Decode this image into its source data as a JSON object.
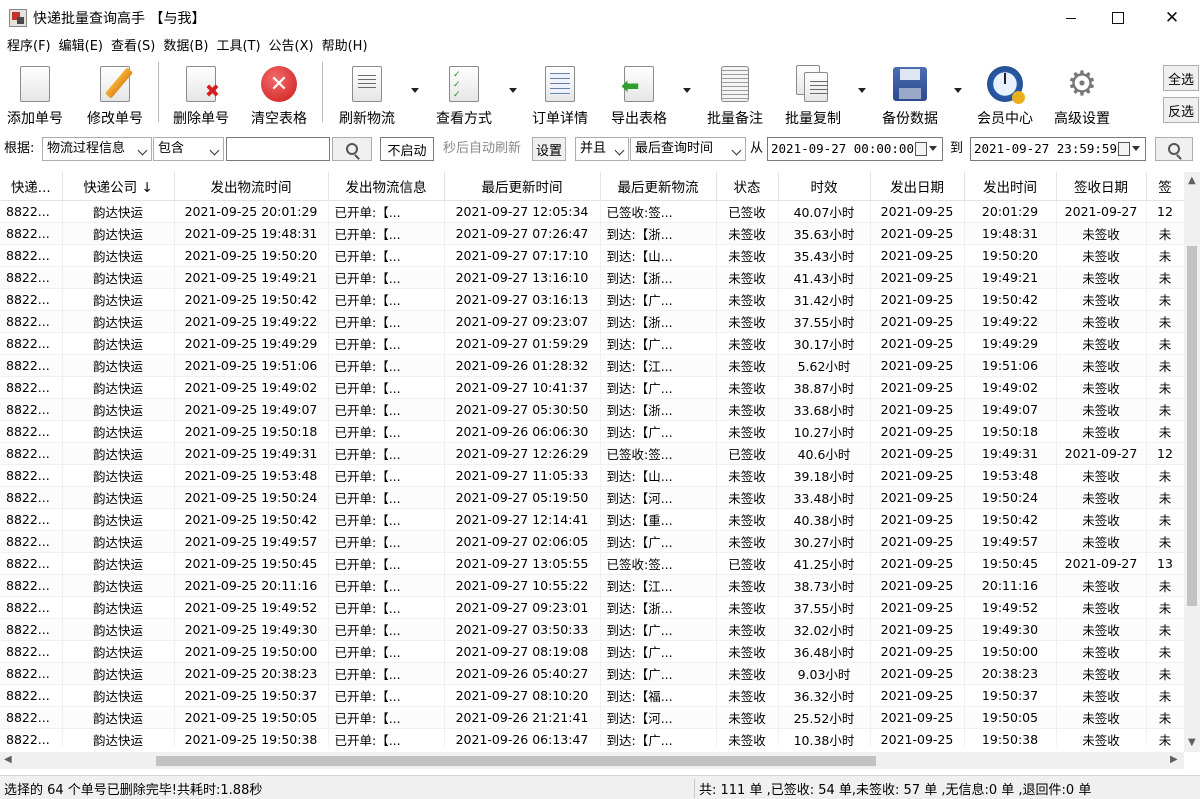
{
  "window": {
    "title": "快递批量查询高手 【与我】"
  },
  "menu": [
    "程序(F)",
    "编辑(E)",
    "查看(S)",
    "数据(B)",
    "工具(T)",
    "公告(X)",
    "帮助(H)"
  ],
  "toolbar": {
    "add": "添加单号",
    "edit": "修改单号",
    "delete": "删除单号",
    "clear": "清空表格",
    "refresh": "刷新物流",
    "view_mode": "查看方式",
    "order_detail": "订单详情",
    "export": "导出表格",
    "batch_note": "批量备注",
    "batch_copy": "批量复制",
    "backup": "备份数据",
    "member": "会员中心",
    "advanced": "高级设置",
    "select_all": "全选",
    "invert": "反选"
  },
  "filter": {
    "basis_label": "根据:",
    "field": "物流过程信息",
    "op": "包含",
    "keyword": "",
    "auto_start": "不启动",
    "auto_hint": "秒后自动刷新",
    "settings": "设置",
    "logic": "并且",
    "time_field": "最后查询时间",
    "from_label": "从",
    "from": "2021-09-27 00:00:00",
    "to_label": "到",
    "to": "2021-09-27 23:59:59"
  },
  "columns": [
    "快递...",
    "快递公司 ↓",
    "发出物流时间",
    "发出物流信息",
    "最后更新时间",
    "最后更新物流",
    "状态",
    "时效",
    "发出日期",
    "发出时间",
    "签收日期",
    "签"
  ],
  "rows": [
    [
      "8822...",
      "韵达快运",
      "2021-09-25 20:01:29",
      "已开单:【...",
      "2021-09-27 12:05:34",
      "已签收:签...",
      "已签收",
      "40.07小时",
      "2021-09-25",
      "20:01:29",
      "2021-09-27",
      "12"
    ],
    [
      "8822...",
      "韵达快运",
      "2021-09-25 19:48:31",
      "已开单:【...",
      "2021-09-27 07:26:47",
      "到达:【浙...",
      "未签收",
      "35.63小时",
      "2021-09-25",
      "19:48:31",
      "未签收",
      "未"
    ],
    [
      "8822...",
      "韵达快运",
      "2021-09-25 19:50:20",
      "已开单:【...",
      "2021-09-27 07:17:10",
      "到达:【山...",
      "未签收",
      "35.43小时",
      "2021-09-25",
      "19:50:20",
      "未签收",
      "未"
    ],
    [
      "8822...",
      "韵达快运",
      "2021-09-25 19:49:21",
      "已开单:【...",
      "2021-09-27 13:16:10",
      "到达:【浙...",
      "未签收",
      "41.43小时",
      "2021-09-25",
      "19:49:21",
      "未签收",
      "未"
    ],
    [
      "8822...",
      "韵达快运",
      "2021-09-25 19:50:42",
      "已开单:【...",
      "2021-09-27 03:16:13",
      "到达:【广...",
      "未签收",
      "31.42小时",
      "2021-09-25",
      "19:50:42",
      "未签收",
      "未"
    ],
    [
      "8822...",
      "韵达快运",
      "2021-09-25 19:49:22",
      "已开单:【...",
      "2021-09-27 09:23:07",
      "到达:【浙...",
      "未签收",
      "37.55小时",
      "2021-09-25",
      "19:49:22",
      "未签收",
      "未"
    ],
    [
      "8822...",
      "韵达快运",
      "2021-09-25 19:49:29",
      "已开单:【...",
      "2021-09-27 01:59:29",
      "到达:【广...",
      "未签收",
      "30.17小时",
      "2021-09-25",
      "19:49:29",
      "未签收",
      "未"
    ],
    [
      "8822...",
      "韵达快运",
      "2021-09-25 19:51:06",
      "已开单:【...",
      "2021-09-26 01:28:32",
      "到达:【江...",
      "未签收",
      "5.62小时",
      "2021-09-25",
      "19:51:06",
      "未签收",
      "未"
    ],
    [
      "8822...",
      "韵达快运",
      "2021-09-25 19:49:02",
      "已开单:【...",
      "2021-09-27 10:41:37",
      "到达:【广...",
      "未签收",
      "38.87小时",
      "2021-09-25",
      "19:49:02",
      "未签收",
      "未"
    ],
    [
      "8822...",
      "韵达快运",
      "2021-09-25 19:49:07",
      "已开单:【...",
      "2021-09-27 05:30:50",
      "到达:【浙...",
      "未签收",
      "33.68小时",
      "2021-09-25",
      "19:49:07",
      "未签收",
      "未"
    ],
    [
      "8822...",
      "韵达快运",
      "2021-09-25 19:50:18",
      "已开单:【...",
      "2021-09-26 06:06:30",
      "到达:【广...",
      "未签收",
      "10.27小时",
      "2021-09-25",
      "19:50:18",
      "未签收",
      "未"
    ],
    [
      "8822...",
      "韵达快运",
      "2021-09-25 19:49:31",
      "已开单:【...",
      "2021-09-27 12:26:29",
      "已签收:签...",
      "已签收",
      "40.6小时",
      "2021-09-25",
      "19:49:31",
      "2021-09-27",
      "12"
    ],
    [
      "8822...",
      "韵达快运",
      "2021-09-25 19:53:48",
      "已开单:【...",
      "2021-09-27 11:05:33",
      "到达:【山...",
      "未签收",
      "39.18小时",
      "2021-09-25",
      "19:53:48",
      "未签收",
      "未"
    ],
    [
      "8822...",
      "韵达快运",
      "2021-09-25 19:50:24",
      "已开单:【...",
      "2021-09-27 05:19:50",
      "到达:【河...",
      "未签收",
      "33.48小时",
      "2021-09-25",
      "19:50:24",
      "未签收",
      "未"
    ],
    [
      "8822...",
      "韵达快运",
      "2021-09-25 19:50:42",
      "已开单:【...",
      "2021-09-27 12:14:41",
      "到达:【重...",
      "未签收",
      "40.38小时",
      "2021-09-25",
      "19:50:42",
      "未签收",
      "未"
    ],
    [
      "8822...",
      "韵达快运",
      "2021-09-25 19:49:57",
      "已开单:【...",
      "2021-09-27 02:06:05",
      "到达:【广...",
      "未签收",
      "30.27小时",
      "2021-09-25",
      "19:49:57",
      "未签收",
      "未"
    ],
    [
      "8822...",
      "韵达快运",
      "2021-09-25 19:50:45",
      "已开单:【...",
      "2021-09-27 13:05:55",
      "已签收:签...",
      "已签收",
      "41.25小时",
      "2021-09-25",
      "19:50:45",
      "2021-09-27",
      "13"
    ],
    [
      "8822...",
      "韵达快运",
      "2021-09-25 20:11:16",
      "已开单:【...",
      "2021-09-27 10:55:22",
      "到达:【江...",
      "未签收",
      "38.73小时",
      "2021-09-25",
      "20:11:16",
      "未签收",
      "未"
    ],
    [
      "8822...",
      "韵达快运",
      "2021-09-25 19:49:52",
      "已开单:【...",
      "2021-09-27 09:23:01",
      "到达:【浙...",
      "未签收",
      "37.55小时",
      "2021-09-25",
      "19:49:52",
      "未签收",
      "未"
    ],
    [
      "8822...",
      "韵达快运",
      "2021-09-25 19:49:30",
      "已开单:【...",
      "2021-09-27 03:50:33",
      "到达:【广...",
      "未签收",
      "32.02小时",
      "2021-09-25",
      "19:49:30",
      "未签收",
      "未"
    ],
    [
      "8822...",
      "韵达快运",
      "2021-09-25 19:50:00",
      "已开单:【...",
      "2021-09-27 08:19:08",
      "到达:【广...",
      "未签收",
      "36.48小时",
      "2021-09-25",
      "19:50:00",
      "未签收",
      "未"
    ],
    [
      "8822...",
      "韵达快运",
      "2021-09-25 20:38:23",
      "已开单:【...",
      "2021-09-26 05:40:27",
      "到达:【广...",
      "未签收",
      "9.03小时",
      "2021-09-25",
      "20:38:23",
      "未签收",
      "未"
    ],
    [
      "8822...",
      "韵达快运",
      "2021-09-25 19:50:37",
      "已开单:【...",
      "2021-09-27 08:10:20",
      "到达:【福...",
      "未签收",
      "36.32小时",
      "2021-09-25",
      "19:50:37",
      "未签收",
      "未"
    ],
    [
      "8822...",
      "韵达快运",
      "2021-09-25 19:50:05",
      "已开单:【...",
      "2021-09-26 21:21:41",
      "到达:【河...",
      "未签收",
      "25.52小时",
      "2021-09-25",
      "19:50:05",
      "未签收",
      "未"
    ],
    [
      "8822...",
      "韵达快运",
      "2021-09-25 19:50:38",
      "已开单:【...",
      "2021-09-26 06:13:47",
      "到达:【广...",
      "未签收",
      "10.38小时",
      "2021-09-25",
      "19:50:38",
      "未签收",
      "未"
    ]
  ],
  "status": {
    "left": "选择的 64 个单号已删除完毕!共耗时:1.88秒",
    "right": "共: 111 单 ,已签收: 54 单,未签收: 57 单 ,无信息:0 单 ,退回件:0 单"
  }
}
